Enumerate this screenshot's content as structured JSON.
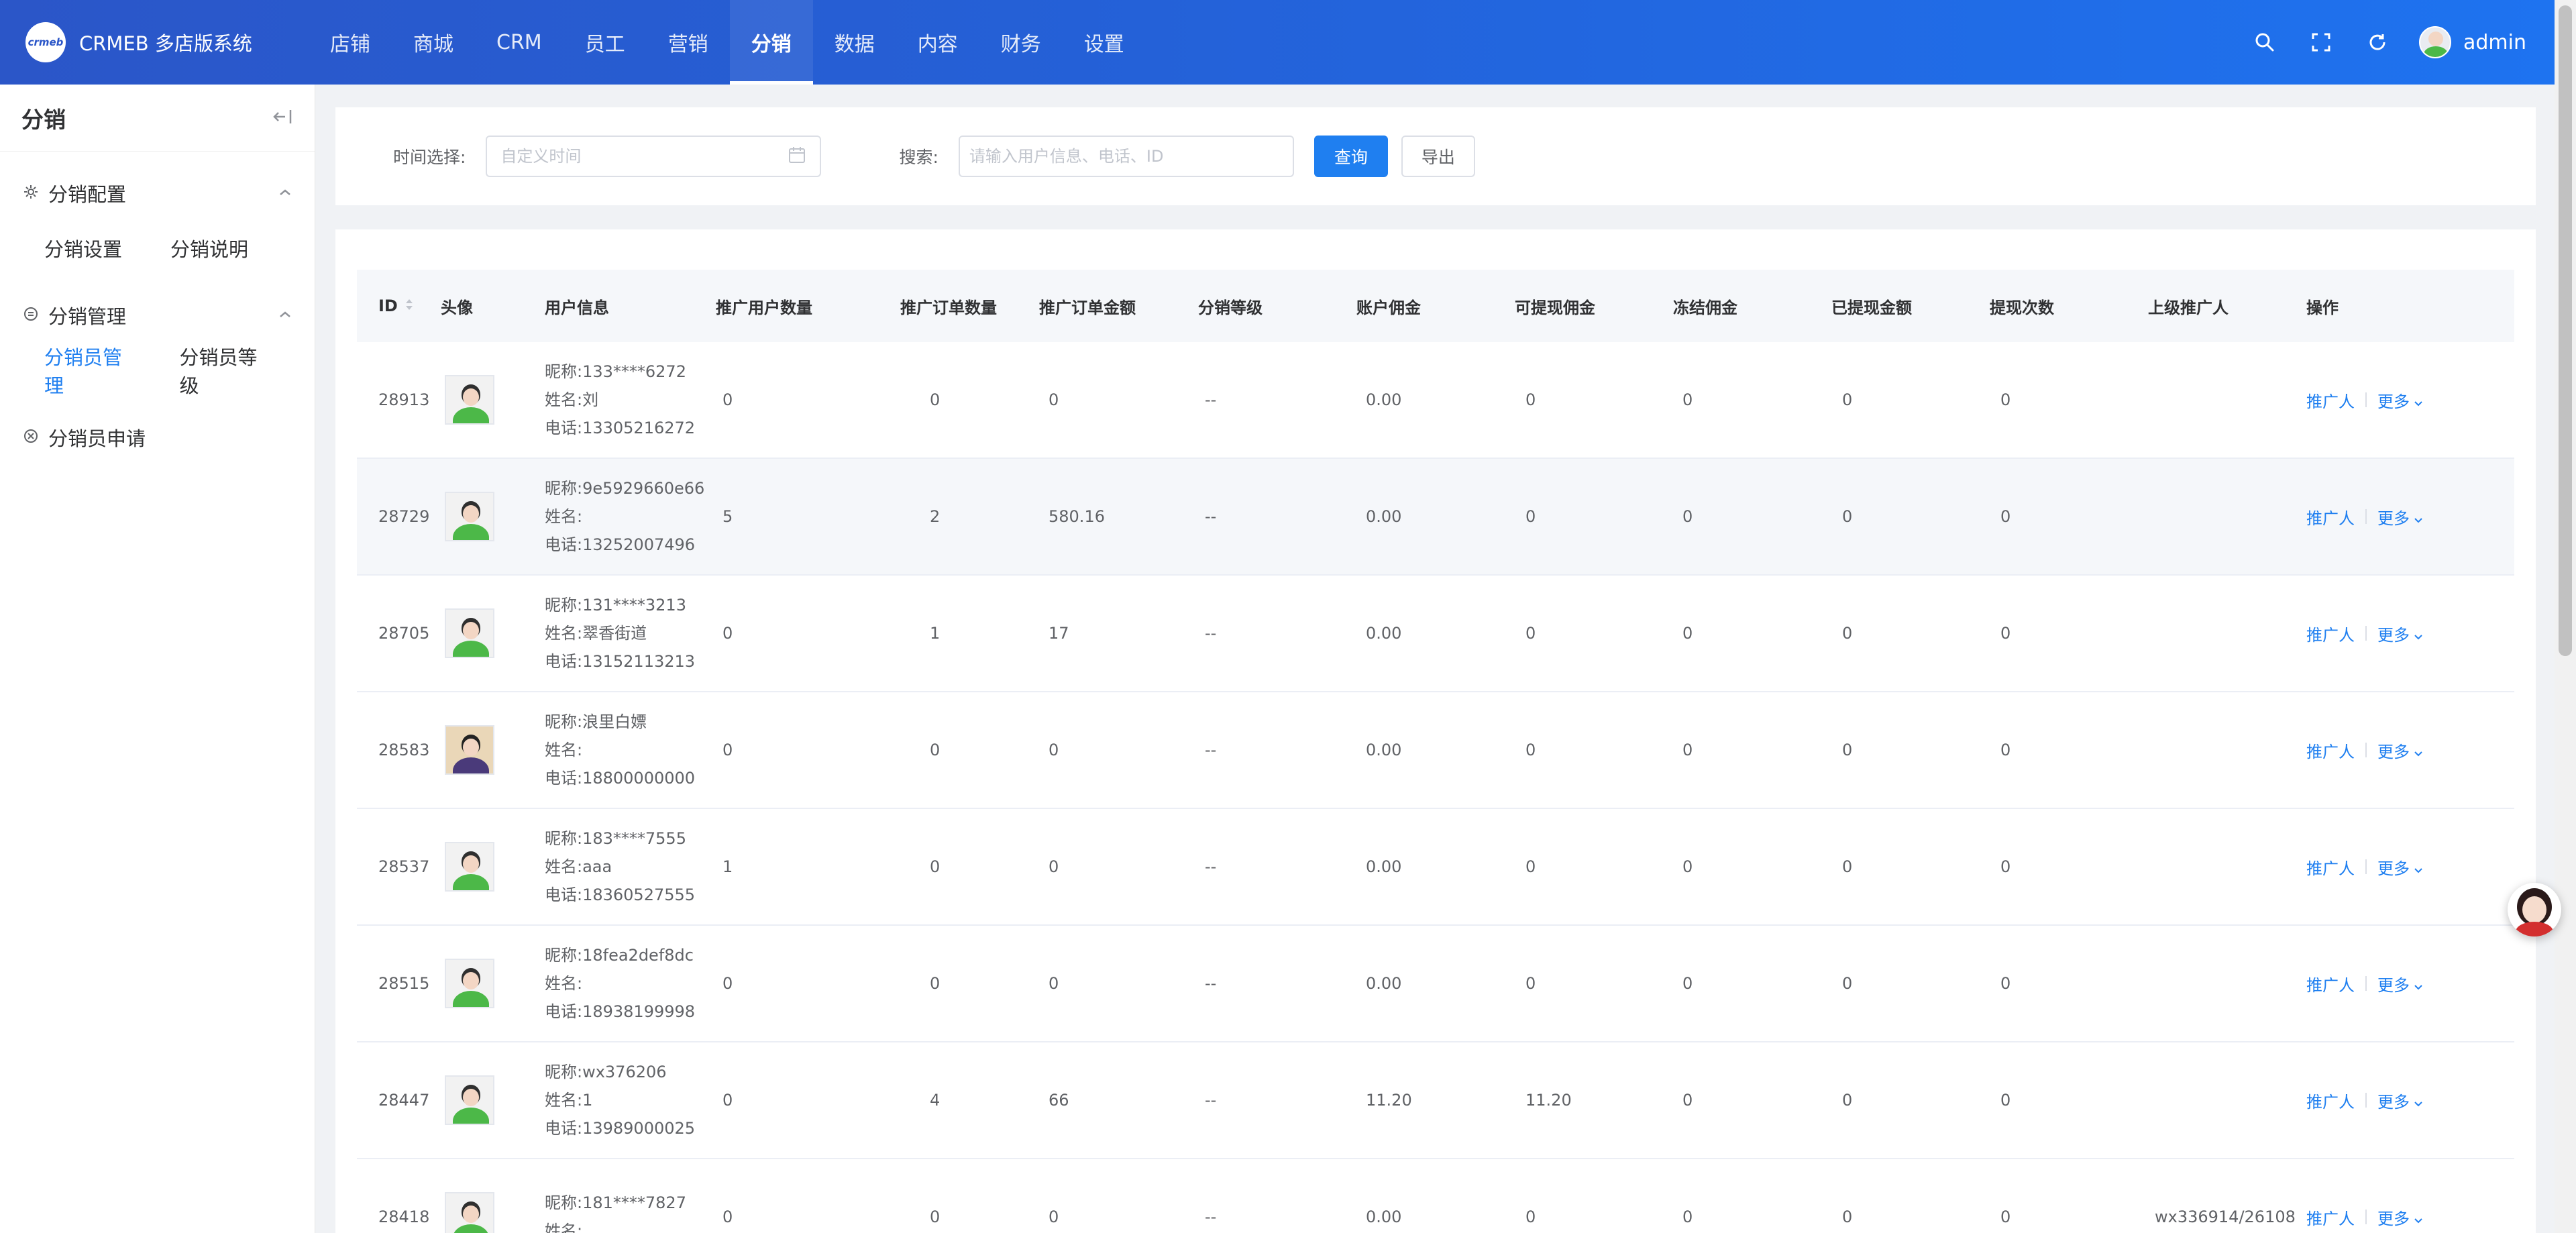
{
  "brand": {
    "name": "CRMEB 多店版系统",
    "logo_text": "crmeb"
  },
  "nav": [
    {
      "label": "店铺",
      "active": false
    },
    {
      "label": "商城",
      "active": false
    },
    {
      "label": "CRM",
      "active": false
    },
    {
      "label": "员工",
      "active": false
    },
    {
      "label": "营销",
      "active": false
    },
    {
      "label": "分销",
      "active": true
    },
    {
      "label": "数据",
      "active": false
    },
    {
      "label": "内容",
      "active": false
    },
    {
      "label": "财务",
      "active": false
    },
    {
      "label": "设置",
      "active": false
    }
  ],
  "header_right": {
    "user": "admin",
    "icons": [
      "search-icon",
      "fullscreen-icon",
      "refresh-icon"
    ]
  },
  "sidebar": {
    "title": "分销",
    "groups": [
      {
        "label": "分销配置",
        "icon": "settings-icon",
        "items": [
          {
            "label": "分销设置",
            "active": false
          },
          {
            "label": "分销说明",
            "active": false
          }
        ]
      },
      {
        "label": "分销管理",
        "icon": "manage-icon",
        "items": [
          {
            "label": "分销员管理",
            "active": true
          },
          {
            "label": "分销员等级",
            "active": false
          }
        ]
      },
      {
        "label": "分销员申请",
        "icon": "apply-icon",
        "items": []
      }
    ]
  },
  "filter": {
    "time_label": "时间选择:",
    "time_placeholder": "自定义时间",
    "search_label": "搜索:",
    "search_placeholder": "请输入用户信息、电话、ID",
    "query_button": "查询",
    "export_button": "导出"
  },
  "table": {
    "columns": [
      "ID",
      "头像",
      "用户信息",
      "推广用户数量",
      "推广订单数量",
      "推广订单金额",
      "分销等级",
      "账户佣金",
      "可提现佣金",
      "冻结佣金",
      "已提现金额",
      "提现次数",
      "上级推广人",
      "操作"
    ],
    "op_labels": {
      "promoter": "推广人",
      "more": "更多"
    },
    "rows": [
      {
        "id": "28913",
        "nickname": "昵称:133****6272",
        "name": "姓名:刘",
        "phone": "电话:13305216272",
        "promo_users": "0",
        "promo_orders": "0",
        "promo_amount": "0",
        "level": "--",
        "commission": "0.00",
        "withdrawable": "0",
        "frozen": "0",
        "withdrawn": "0",
        "withdraw_count": "0",
        "superior": ""
      },
      {
        "id": "28729",
        "nickname": "昵称:9e5929660e66",
        "name": "姓名:",
        "phone": "电话:13252007496",
        "promo_users": "5",
        "promo_orders": "2",
        "promo_amount": "580.16",
        "level": "--",
        "commission": "0.00",
        "withdrawable": "0",
        "frozen": "0",
        "withdrawn": "0",
        "withdraw_count": "0",
        "superior": ""
      },
      {
        "id": "28705",
        "nickname": "昵称:131****3213",
        "name": "姓名:翠香街道",
        "phone": "电话:13152113213",
        "promo_users": "0",
        "promo_orders": "1",
        "promo_amount": "17",
        "level": "--",
        "commission": "0.00",
        "withdrawable": "0",
        "frozen": "0",
        "withdrawn": "0",
        "withdraw_count": "0",
        "superior": ""
      },
      {
        "id": "28583",
        "nickname": "昵称:浪里白嫖",
        "name": "姓名:",
        "phone": "电话:18800000000",
        "promo_users": "0",
        "promo_orders": "0",
        "promo_amount": "0",
        "level": "--",
        "commission": "0.00",
        "withdrawable": "0",
        "frozen": "0",
        "withdrawn": "0",
        "withdraw_count": "0",
        "superior": ""
      },
      {
        "id": "28537",
        "nickname": "昵称:183****7555",
        "name": "姓名:aaa",
        "phone": "电话:18360527555",
        "promo_users": "1",
        "promo_orders": "0",
        "promo_amount": "0",
        "level": "--",
        "commission": "0.00",
        "withdrawable": "0",
        "frozen": "0",
        "withdrawn": "0",
        "withdraw_count": "0",
        "superior": ""
      },
      {
        "id": "28515",
        "nickname": "昵称:18fea2def8dc",
        "name": "姓名:",
        "phone": "电话:18938199998",
        "promo_users": "0",
        "promo_orders": "0",
        "promo_amount": "0",
        "level": "--",
        "commission": "0.00",
        "withdrawable": "0",
        "frozen": "0",
        "withdrawn": "0",
        "withdraw_count": "0",
        "superior": ""
      },
      {
        "id": "28447",
        "nickname": "昵称:wx376206",
        "name": "姓名:1",
        "phone": "电话:13989000025",
        "promo_users": "0",
        "promo_orders": "4",
        "promo_amount": "66",
        "level": "--",
        "commission": "11.20",
        "withdrawable": "11.20",
        "frozen": "0",
        "withdrawn": "0",
        "withdraw_count": "0",
        "superior": ""
      },
      {
        "id": "28418",
        "nickname": "昵称:181****7827",
        "name": "姓名:",
        "phone": "",
        "promo_users": "0",
        "promo_orders": "0",
        "promo_amount": "0",
        "level": "--",
        "commission": "0.00",
        "withdrawable": "0",
        "frozen": "0",
        "withdrawn": "0",
        "withdraw_count": "0",
        "superior": "wx336914/26108"
      }
    ]
  },
  "colors": {
    "primary": "#1f7ff0",
    "header_start": "#2b56c8",
    "header_end": "#1e73f0"
  }
}
